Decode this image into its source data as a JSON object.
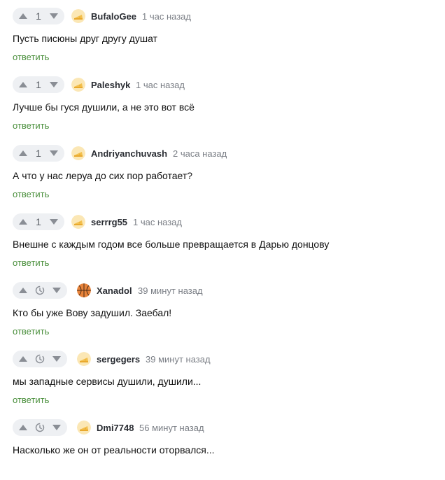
{
  "reply_label": "ответить",
  "colors": {
    "reply": "#4a8f3c",
    "vote_bg": "#eef0f3",
    "vote_icon": "#8a8e95"
  },
  "comments": [
    {
      "score": "1",
      "author": "BufaloGee",
      "time": "1 час назад",
      "text": "Пусть писюны друг другу душат",
      "avatar": "cheese-avatar-icon"
    },
    {
      "score": "1",
      "author": "Paleshyk",
      "time": "1 час назад",
      "text": "Лучше бы гуся душили, а не это вот всё",
      "avatar": "cheese-avatar-icon"
    },
    {
      "score": "1",
      "author": "Andriyanchuvash",
      "time": "2 часа назад",
      "text": "А что у нас леруа до сих пор работает?",
      "avatar": "cheese-avatar-icon"
    },
    {
      "score": "1",
      "author": "serrrg55",
      "time": "1 час назад",
      "text": "Внешне с каждым годом все больше превращается в Дарью донцову",
      "avatar": "cheese-avatar-icon"
    },
    {
      "score": null,
      "author": "Xanadol",
      "time": "39 минут назад",
      "text": "Кто бы уже Вову задушил. Заебал!",
      "avatar": "basketball-avatar-icon"
    },
    {
      "score": null,
      "author": "sergegers",
      "time": "39 минут назад",
      "text": "мы западные сервисы душили, душили...",
      "avatar": "cheese-avatar-icon"
    },
    {
      "score": null,
      "author": "Dmi7748",
      "time": "56 минут назад",
      "text": "Насколько же он от реальности оторвался...",
      "avatar": "cheese-avatar-icon"
    }
  ]
}
